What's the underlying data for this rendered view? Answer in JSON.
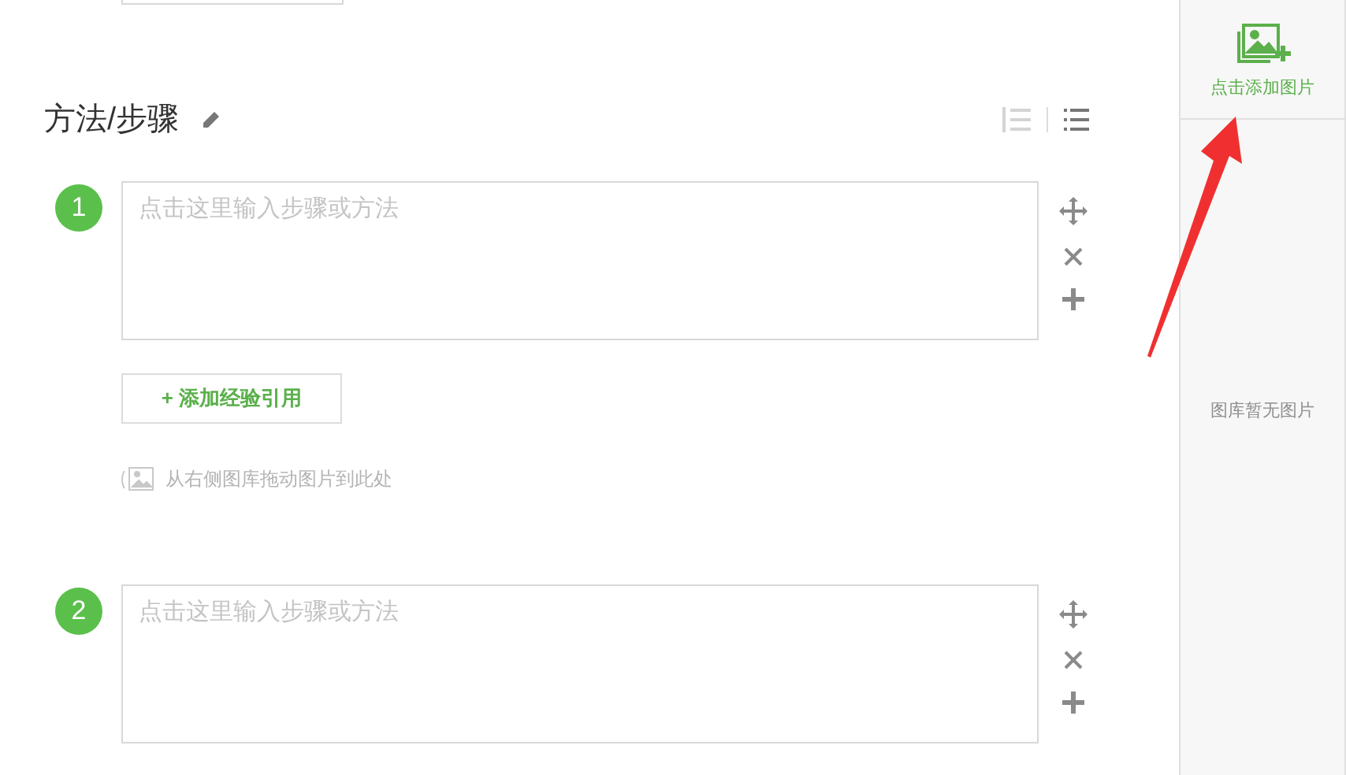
{
  "section": {
    "title": "方法/步骤"
  },
  "steps": [
    {
      "number": "1",
      "placeholder": "点击这里输入步骤或方法",
      "add_reference": "+ 添加经验引用",
      "drag_hint": "从右侧图库拖动图片到此处"
    },
    {
      "number": "2",
      "placeholder": "点击这里输入步骤或方法"
    }
  ],
  "sidebar": {
    "add_image": "点击添加图片",
    "empty_text": "图库暂无图片"
  }
}
